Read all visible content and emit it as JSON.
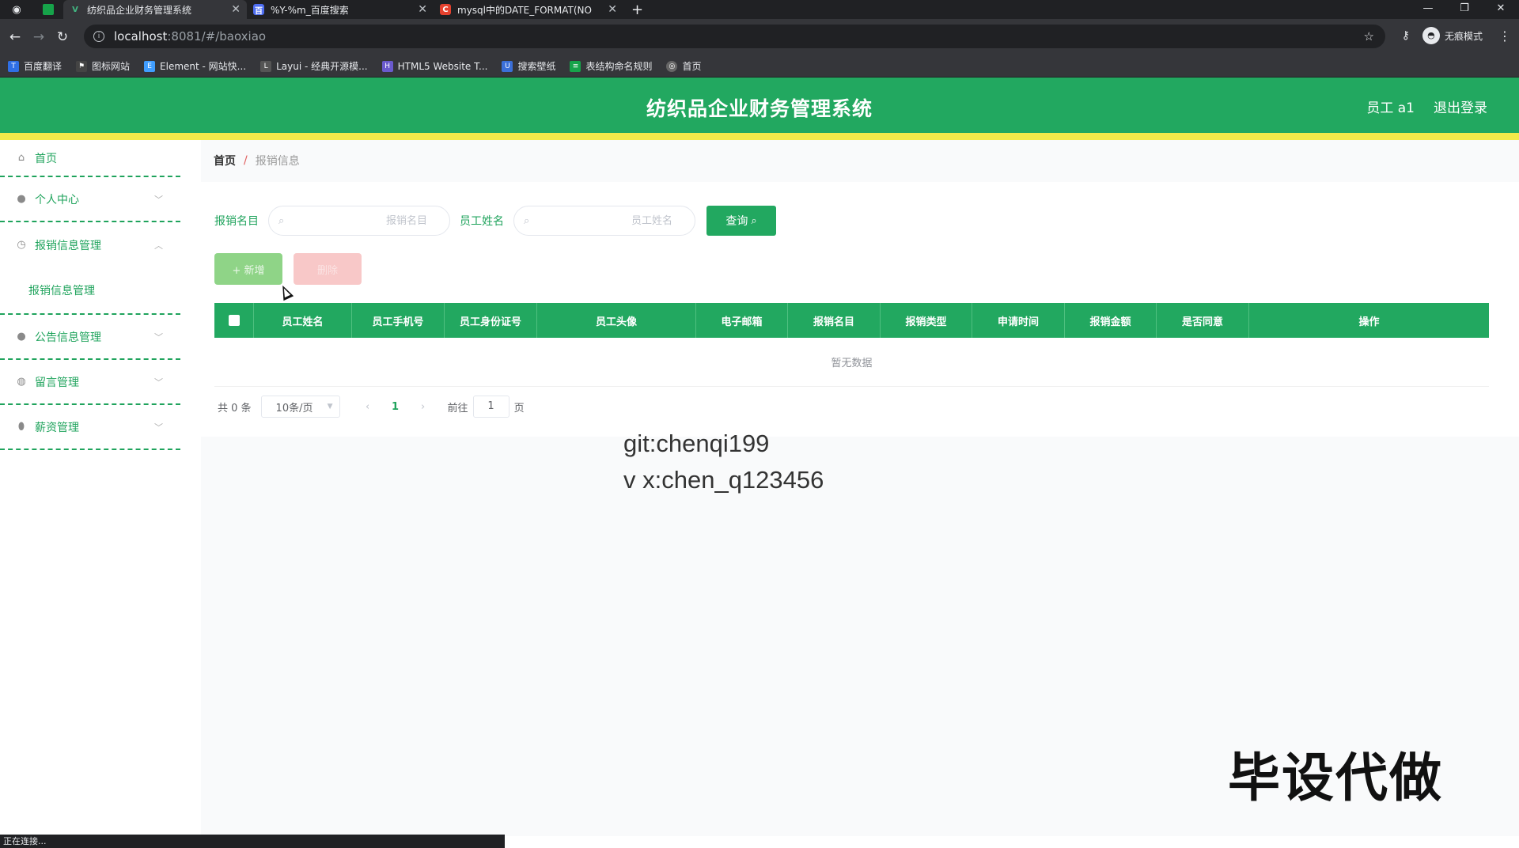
{
  "browser": {
    "tabs": [
      {
        "title": "纺织品企业财务管理系统",
        "favicon": "V",
        "color": "#42b883"
      },
      {
        "title": "%Y-%m_百度搜索",
        "favicon": "百",
        "color": "#4e6ef2"
      },
      {
        "title": "mysql中的DATE_FORMAT(NO",
        "favicon": "C",
        "color": "#e5412e"
      }
    ],
    "url_host": "localhost",
    "url_path": ":8081/#/baoxiao",
    "incognito_label": "无痕模式",
    "bookmarks": [
      {
        "label": "百度翻译",
        "color": "#2f6fe4"
      },
      {
        "label": "图标网站",
        "color": "#444444"
      },
      {
        "label": "Element - 网站快...",
        "color": "#409eff"
      },
      {
        "label": "Layui - 经典开源模...",
        "color": "#555555"
      },
      {
        "label": "HTML5 Website T...",
        "color": "#6a5acd"
      },
      {
        "label": "搜索壁纸",
        "color": "#3b6fd8"
      },
      {
        "label": "表结构命名规则",
        "color": "#16a34a"
      },
      {
        "label": "首页",
        "color": "#666666"
      }
    ],
    "status_text": "正在连接..."
  },
  "header": {
    "title": "纺织品企业财务管理系统",
    "user": "员工 a1",
    "logout": "退出登录"
  },
  "sidebar": {
    "items": [
      {
        "label": "首页",
        "icon": "home-icon"
      },
      {
        "label": "个人中心",
        "icon": "user-icon"
      },
      {
        "label": "报销信息管理",
        "icon": "clock-icon"
      },
      {
        "label": "报销信息管理",
        "icon": "submenu"
      },
      {
        "label": "公告信息管理",
        "icon": "user-icon"
      },
      {
        "label": "留言管理",
        "icon": "globe-icon"
      },
      {
        "label": "薪资管理",
        "icon": "pin-icon"
      }
    ]
  },
  "breadcrumb": {
    "home": "首页",
    "separator": "/",
    "current": "报销信息"
  },
  "search": {
    "field1_label": "报销名目",
    "field1_placeholder": "报销名目",
    "field2_label": "员工姓名",
    "field2_placeholder": "员工姓名",
    "query_label": "查询"
  },
  "actions": {
    "add_label": "+ 新增",
    "delete_label": "删除"
  },
  "table": {
    "columns": [
      "员工姓名",
      "员工手机号",
      "员工身份证号",
      "员工头像",
      "电子邮箱",
      "报销名目",
      "报销类型",
      "申请时间",
      "报销金额",
      "是否同意",
      "操作"
    ],
    "empty_text": "暂无数据"
  },
  "pagination": {
    "total_text": "共 0 条",
    "page_size": "10条/页",
    "current_page": "1",
    "goto_label": "前往",
    "goto_value": "1",
    "page_unit": "页"
  },
  "overlay": {
    "watermark_line1": "git:chenqi199",
    "watermark_line2": "v x:chen_q123456",
    "promo": "毕设代做"
  },
  "colors": {
    "primary": "#22a860",
    "accent_yellow": "#f3ea4a"
  }
}
